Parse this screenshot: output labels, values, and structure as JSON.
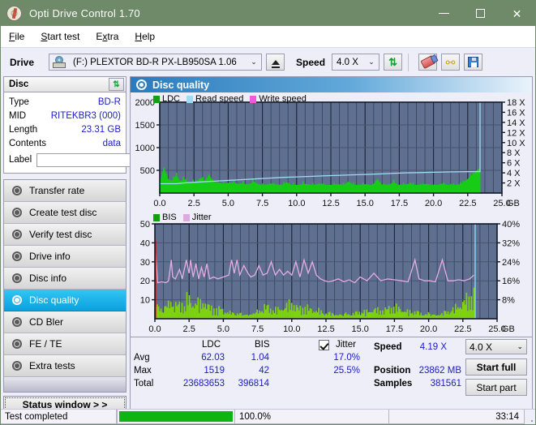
{
  "window": {
    "title": "Opti Drive Control 1.70",
    "icon": "disc-icon",
    "minimize": "−",
    "maximize": "□",
    "close": "✕"
  },
  "menu": [
    {
      "label": "File",
      "accel": "F"
    },
    {
      "label": "Start test",
      "accel": "S"
    },
    {
      "label": "Extra",
      "accel": "x"
    },
    {
      "label": "Help",
      "accel": "H"
    }
  ],
  "toolbar": {
    "drive_label": "Drive",
    "drive_value": "(F:)  PLEXTOR BD-R  PX-LB950SA 1.06",
    "eject_icon": "eject-icon",
    "speed_label": "Speed",
    "speed_value": "4.0 X",
    "refresh_icon": "refresh-icon",
    "erase_icon": "eraser-icon",
    "settings_icon": "plug-icon",
    "save_icon": "save-icon",
    "arrow": "⌄"
  },
  "disc_panel": {
    "title": "Disc",
    "refresh_icon": "refresh-icon",
    "rows": [
      {
        "key": "Type",
        "value": "BD-R"
      },
      {
        "key": "MID",
        "value": "RITEKBR3 (000)"
      },
      {
        "key": "Length",
        "value": "23.31 GB"
      },
      {
        "key": "Contents",
        "value": "data"
      }
    ],
    "label_key": "Label",
    "label_value": "",
    "label_placeholder": "",
    "disc_icon": "cd-icon"
  },
  "nav": {
    "items": [
      {
        "label": "Transfer rate",
        "icon": "disc-test-icon",
        "selected": false
      },
      {
        "label": "Create test disc",
        "icon": "disc-write-icon",
        "selected": false
      },
      {
        "label": "Verify test disc",
        "icon": "disc-verify-icon",
        "selected": false
      },
      {
        "label": "Drive info",
        "icon": "drive-info-icon",
        "selected": false
      },
      {
        "label": "Disc info",
        "icon": "disc-info-icon",
        "selected": false
      },
      {
        "label": "Disc quality",
        "icon": "disc-quality-icon",
        "selected": true
      },
      {
        "label": "CD Bler",
        "icon": "cd-bler-icon",
        "selected": false
      },
      {
        "label": "FE / TE",
        "icon": "fe-te-icon",
        "selected": false
      },
      {
        "label": "Extra tests",
        "icon": "extra-tests-icon",
        "selected": false
      }
    ],
    "status_window_button": "Status window > >"
  },
  "content": {
    "header_title": "Disc quality",
    "header_icon": "disc-quality-icon"
  },
  "chart_data": [
    {
      "type": "area",
      "name": "ldc-chart",
      "title": "",
      "xlabel": "GB",
      "ylabel": "",
      "xlim": [
        0,
        25
      ],
      "ylim": [
        0,
        2000
      ],
      "y2lim": [
        0,
        18
      ],
      "y2label": "X",
      "xticks": [
        "0.0",
        "2.5",
        "5.0",
        "7.5",
        "10.0",
        "12.5",
        "15.0",
        "17.5",
        "20.0",
        "22.5",
        "25.0"
      ],
      "yticks": [
        "500",
        "1000",
        "1500",
        "2000"
      ],
      "y2ticks": [
        "2 X",
        "4 X",
        "6 X",
        "8 X",
        "10 X",
        "12 X",
        "14 X",
        "16 X",
        "18 X"
      ],
      "grid": true,
      "legend": [
        {
          "label": "LDC",
          "color": "#13a010"
        },
        {
          "label": "Read speed",
          "color": "#9fdcf5"
        },
        {
          "label": "Write speed",
          "color": "#f558d8"
        }
      ],
      "series": [
        {
          "name": "LDC",
          "color": "#16cc16",
          "kind": "area",
          "x": [
            0.0,
            0.3,
            0.6,
            0.9,
            1.2,
            1.5,
            1.8,
            2.1,
            2.4,
            2.7,
            3.0,
            3.3,
            3.6,
            3.9,
            4.2,
            4.5,
            4.8,
            5.1,
            5.4,
            5.7,
            6.0,
            6.3,
            6.6,
            6.9,
            7.2,
            7.5,
            7.8,
            8.1,
            8.4,
            8.7,
            9.0,
            9.3,
            9.6,
            9.9,
            10.2,
            10.5,
            10.8,
            11.1,
            11.4,
            11.7,
            12.0,
            12.3,
            12.6,
            12.9,
            13.2,
            13.5,
            13.8,
            14.1,
            14.4,
            14.7,
            15.0,
            15.3,
            15.6,
            15.9,
            16.2,
            16.5,
            16.8,
            17.1,
            17.4,
            17.7,
            18.0,
            18.3,
            18.6,
            18.9,
            19.2,
            19.5,
            19.8,
            20.1,
            20.4,
            20.7,
            21.0,
            21.3,
            21.6,
            21.9,
            22.2,
            22.5,
            22.8,
            23.1,
            23.4
          ],
          "values": [
            210,
            530,
            300,
            260,
            380,
            250,
            300,
            215,
            230,
            250,
            330,
            240,
            400,
            235,
            230,
            215,
            200,
            225,
            215,
            190,
            210,
            185,
            195,
            240,
            185,
            175,
            180,
            200,
            185,
            175,
            180,
            230,
            175,
            170,
            175,
            195,
            185,
            175,
            180,
            200,
            175,
            170,
            175,
            185,
            180,
            175,
            245,
            180,
            170,
            175,
            185,
            175,
            170,
            300,
            180,
            175,
            180,
            230,
            175,
            170,
            185,
            200,
            175,
            170,
            180,
            195,
            175,
            170,
            175,
            200,
            175,
            170,
            175,
            185,
            230,
            300,
            380,
            470,
            550
          ]
        },
        {
          "name": "Read speed",
          "color": "#9fdcf5",
          "kind": "line",
          "x": [
            0.0,
            1.2,
            2.0,
            3.0,
            4.0,
            5.0,
            6.0,
            7.0,
            8.0,
            9.0,
            10.0,
            11.0,
            12.0,
            13.0,
            14.0,
            15.0,
            16.0,
            17.0,
            18.0,
            19.0,
            20.0,
            21.0,
            22.0,
            22.8,
            23.4,
            23.4
          ],
          "values": [
            1.85,
            1.85,
            2.05,
            2.2,
            2.35,
            2.5,
            2.65,
            2.8,
            2.95,
            3.1,
            3.2,
            3.3,
            3.42,
            3.5,
            3.6,
            3.68,
            3.78,
            3.9,
            4.0,
            4.05,
            4.12,
            4.18,
            4.22,
            4.25,
            4.25,
            18.0
          ]
        }
      ]
    },
    {
      "type": "area",
      "name": "bis-jitter-chart",
      "title": "",
      "xlabel": "GB",
      "ylabel": "",
      "xlim": [
        0,
        25
      ],
      "ylim": [
        0,
        50
      ],
      "y2lim": [
        0,
        40
      ],
      "y2label": "%",
      "xticks": [
        "0.0",
        "2.5",
        "5.0",
        "7.5",
        "10.0",
        "12.5",
        "15.0",
        "17.5",
        "20.0",
        "22.5",
        "25.0"
      ],
      "yticks": [
        "10",
        "20",
        "30",
        "40",
        "50"
      ],
      "y2ticks": [
        "8%",
        "16%",
        "24%",
        "32%",
        "40%"
      ],
      "grid": true,
      "legend": [
        {
          "label": "BIS",
          "color": "#13a010"
        },
        {
          "label": "Jitter",
          "color": "#e0a8e0"
        }
      ],
      "series": [
        {
          "name": "BIS",
          "color": "#7ed210",
          "kind": "bars",
          "x": [
            0.0,
            0.2,
            0.4,
            0.6,
            0.8,
            1.0,
            1.2,
            1.4,
            1.6,
            1.8,
            2.0,
            2.2,
            2.4,
            2.6,
            2.8,
            3.0,
            3.2,
            3.4,
            3.6,
            3.8,
            4.0,
            4.2,
            4.4,
            4.6,
            4.8,
            5.0,
            5.5,
            6.0,
            6.5,
            7.0,
            7.5,
            8.0,
            8.5,
            9.0,
            9.5,
            10.0,
            10.5,
            11.0,
            11.5,
            12.0,
            12.5,
            13.0,
            13.5,
            14.0,
            14.5,
            15.0,
            15.5,
            16.0,
            16.5,
            17.0,
            17.5,
            18.0,
            18.5,
            19.0,
            19.5,
            20.0,
            20.5,
            21.0,
            21.5,
            22.0,
            22.5,
            22.9,
            23.2,
            23.4
          ],
          "values": [
            16,
            12,
            11,
            10,
            11,
            10,
            13,
            10,
            9,
            8,
            9,
            7,
            13,
            8,
            7,
            9,
            8,
            7,
            9,
            7,
            6,
            5,
            6,
            5,
            6,
            5,
            4,
            5,
            4,
            5,
            6,
            9,
            6,
            5,
            6,
            8,
            5,
            6,
            5,
            5,
            4,
            5,
            4,
            5,
            4,
            5,
            4,
            5,
            4,
            5,
            6,
            5,
            4,
            5,
            4,
            5,
            4,
            5,
            6,
            7,
            9,
            11,
            12,
            13
          ]
        },
        {
          "name": "Jitter",
          "color": "#e4aee4",
          "kind": "line",
          "x": [
            0.0,
            0.2,
            0.5,
            0.8,
            1.0,
            1.2,
            1.3,
            1.5,
            1.8,
            2.0,
            2.3,
            2.5,
            2.6,
            2.8,
            3.0,
            3.2,
            3.4,
            3.6,
            3.8,
            4.0,
            4.3,
            4.6,
            5.0,
            5.4,
            5.6,
            5.8,
            6.0,
            6.2,
            6.5,
            6.8,
            7.0,
            7.3,
            7.6,
            7.9,
            8.2,
            8.5,
            8.8,
            9.1,
            9.4,
            9.7,
            10.0,
            10.3,
            10.6,
            10.9,
            11.2,
            11.5,
            11.8,
            12.1,
            12.4,
            12.7,
            13.0,
            13.4,
            13.8,
            14.2,
            14.6,
            15.0,
            15.5,
            16.0,
            16.5,
            17.0,
            17.5,
            18.0,
            18.5,
            19.0,
            19.3,
            19.7,
            20.1,
            20.5,
            21.0,
            21.4,
            21.8,
            22.2,
            22.6,
            23.0,
            23.3
          ],
          "values": [
            41,
            19,
            19.5,
            19,
            20,
            31,
            22,
            21,
            26,
            21,
            31,
            24,
            31,
            22,
            29,
            21,
            27,
            22,
            29,
            21,
            22,
            21,
            22,
            23,
            31,
            24,
            31,
            23,
            28,
            24,
            22,
            23,
            28,
            23,
            24,
            30,
            23,
            26,
            23,
            25,
            23,
            30,
            22,
            31,
            24,
            30,
            23,
            21,
            20,
            19.5,
            20,
            21,
            19.5,
            20.5,
            19,
            22,
            20,
            24,
            20,
            21,
            20.5,
            20,
            19.5,
            31,
            21,
            20,
            20,
            19.5,
            31,
            20,
            20,
            20.5,
            20,
            21,
            23
          ]
        }
      ],
      "cursor_x": 23.4
    }
  ],
  "stats": {
    "col_ldc": "LDC",
    "col_bis": "BIS",
    "jitter_label": "Jitter",
    "jitter_checked": true,
    "row_avg": "Avg",
    "row_max": "Max",
    "row_total": "Total",
    "ldc_avg": "62.03",
    "ldc_max": "1519",
    "ldc_total": "23683653",
    "bis_avg": "1.04",
    "bis_max": "42",
    "bis_total": "396814",
    "jitter_avg": "17.0%",
    "jitter_max": "25.5%",
    "speed_label": "Speed",
    "speed_value": "4.19 X",
    "position_label": "Position",
    "position_value": "23862 MB",
    "samples_label": "Samples",
    "samples_value": "381561",
    "speed_select": "4.0 X",
    "speed_select_arrow": "⌄",
    "start_full": "Start full",
    "start_part": "Start part"
  },
  "statusbar": {
    "text": "Test completed",
    "progress_percent": "100.0%",
    "progress_value": 100,
    "elapsed": "33:14"
  }
}
